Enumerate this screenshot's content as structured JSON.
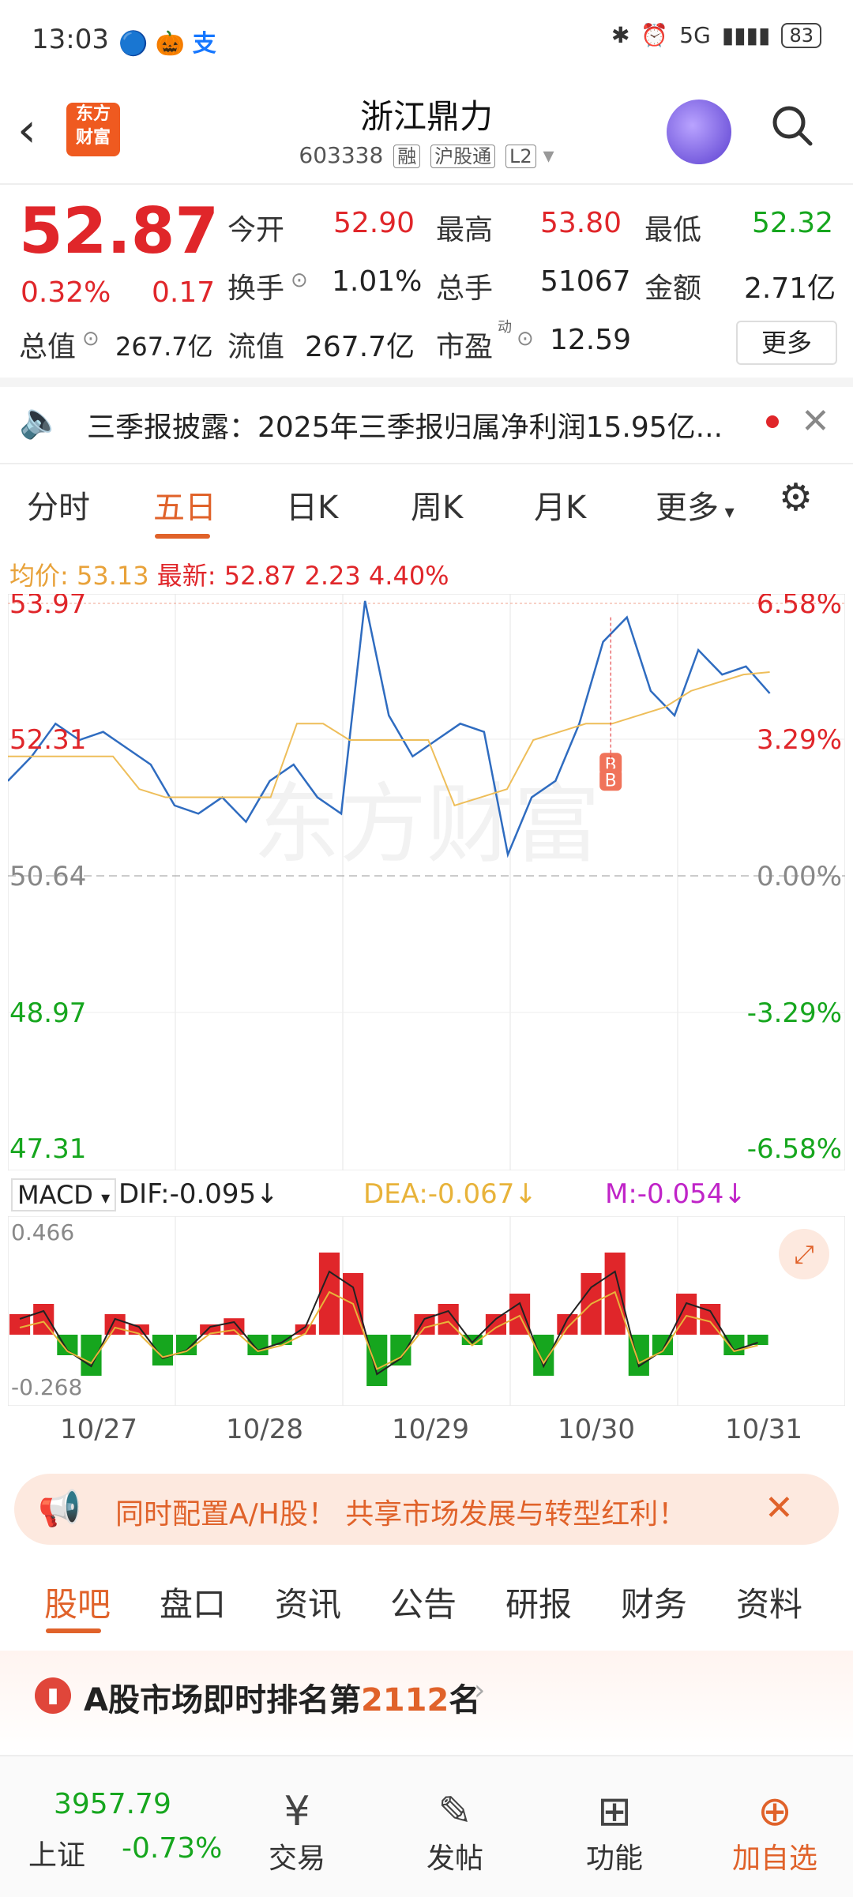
{
  "status_bar": {
    "time": "13:03",
    "battery": "83",
    "network": "5G"
  },
  "header": {
    "stock_name": "浙江鼎力",
    "code": "603338",
    "tag1": "融",
    "tag2": "沪股通",
    "tag3": "L2",
    "logo_line1": "东方",
    "logo_line2": "财富"
  },
  "quote": {
    "price": "52.87",
    "pct": "0.32%",
    "chg": "0.17",
    "open_label": "今开",
    "open": "52.90",
    "high_label": "最高",
    "high": "53.80",
    "low_label": "最低",
    "low": "52.32",
    "turnover_label": "换手",
    "turnover": "1.01%",
    "volume_label": "总手",
    "volume": "51067",
    "amount_label": "金额",
    "amount": "2.71亿",
    "mktcap_label": "总值",
    "mktcap": "267.7亿",
    "float_label": "流值",
    "float": "267.7亿",
    "pe_label": "市盈",
    "pe_super": "动",
    "pe": "12.59",
    "more": "更多"
  },
  "notice": {
    "text": "三季报披露：2025年三季报归属净利润15.95亿..."
  },
  "chart_tabs": [
    "分时",
    "五日",
    "日K",
    "周K",
    "月K",
    "更多"
  ],
  "avg_line": {
    "avg_label": "均价:",
    "avg": "53.13",
    "latest_label": "最新:",
    "latest": "52.87",
    "chg": "2.23",
    "pct": "4.40%"
  },
  "chart_data": {
    "type": "line",
    "y_left_ticks": [
      "53.97",
      "52.31",
      "50.64",
      "48.97",
      "47.31"
    ],
    "y_right_ticks": [
      "6.58%",
      "3.29%",
      "0.00%",
      "-3.29%",
      "-6.58%"
    ],
    "ylim": [
      47.31,
      53.97
    ],
    "prev_close": 50.64,
    "categories": [
      "10/27",
      "10/28",
      "10/29",
      "10/30",
      "10/31"
    ],
    "series": [
      {
        "values": [
          51.8,
          52.1,
          52.5,
          52.3,
          52.4,
          52.2,
          52.0,
          51.5,
          51.4,
          51.6,
          51.3,
          51.8,
          52.0,
          51.6,
          51.4,
          54.0,
          52.6,
          52.1,
          52.3,
          52.5,
          52.4,
          50.9,
          51.6,
          51.8,
          52.5,
          53.5,
          53.8,
          52.9,
          52.6,
          53.4,
          53.1,
          53.2,
          52.87
        ]
      },
      {
        "values": [
          52.1,
          52.1,
          52.1,
          52.1,
          52.1,
          51.7,
          51.6,
          51.6,
          51.6,
          51.6,
          51.6,
          52.5,
          52.5,
          52.3,
          52.3,
          52.3,
          52.3,
          51.5,
          51.6,
          51.7,
          52.3,
          52.4,
          52.5,
          52.5,
          52.6,
          52.7,
          52.9,
          53.0,
          53.1,
          53.13
        ]
      }
    ],
    "markers": [
      "B",
      "B"
    ],
    "watermark": "东方财富"
  },
  "macd": {
    "label": "MACD",
    "dif": "DIF:-0.095↓",
    "dea": "DEA:-0.067↓",
    "m": "M:-0.054↓",
    "top": "0.466",
    "bottom": "-0.268",
    "bars": [
      0.1,
      0.15,
      -0.1,
      -0.2,
      0.1,
      0.05,
      -0.15,
      -0.1,
      0.05,
      0.08,
      -0.1,
      -0.05,
      0.05,
      0.4,
      0.3,
      -0.25,
      -0.15,
      0.1,
      0.15,
      -0.05,
      0.1,
      0.2,
      -0.2,
      0.1,
      0.3,
      0.4,
      -0.2,
      -0.1,
      0.2,
      0.15,
      -0.1,
      -0.05
    ]
  },
  "promo": {
    "text": "同时配置A/H股！ 共享市场发展与转型红利！"
  },
  "bottom_tabs": [
    "股吧",
    "盘口",
    "资讯",
    "公告",
    "研报",
    "财务",
    "资料"
  ],
  "rank": {
    "prefix": "A股市场即时排名第",
    "num": "2112",
    "suffix": "名"
  },
  "bottom_bar": {
    "index_value": "3957.79",
    "index_name": "上证",
    "index_pct": "-0.73%",
    "trade": "交易",
    "post": "发帖",
    "func": "功能",
    "add": "加自选"
  }
}
